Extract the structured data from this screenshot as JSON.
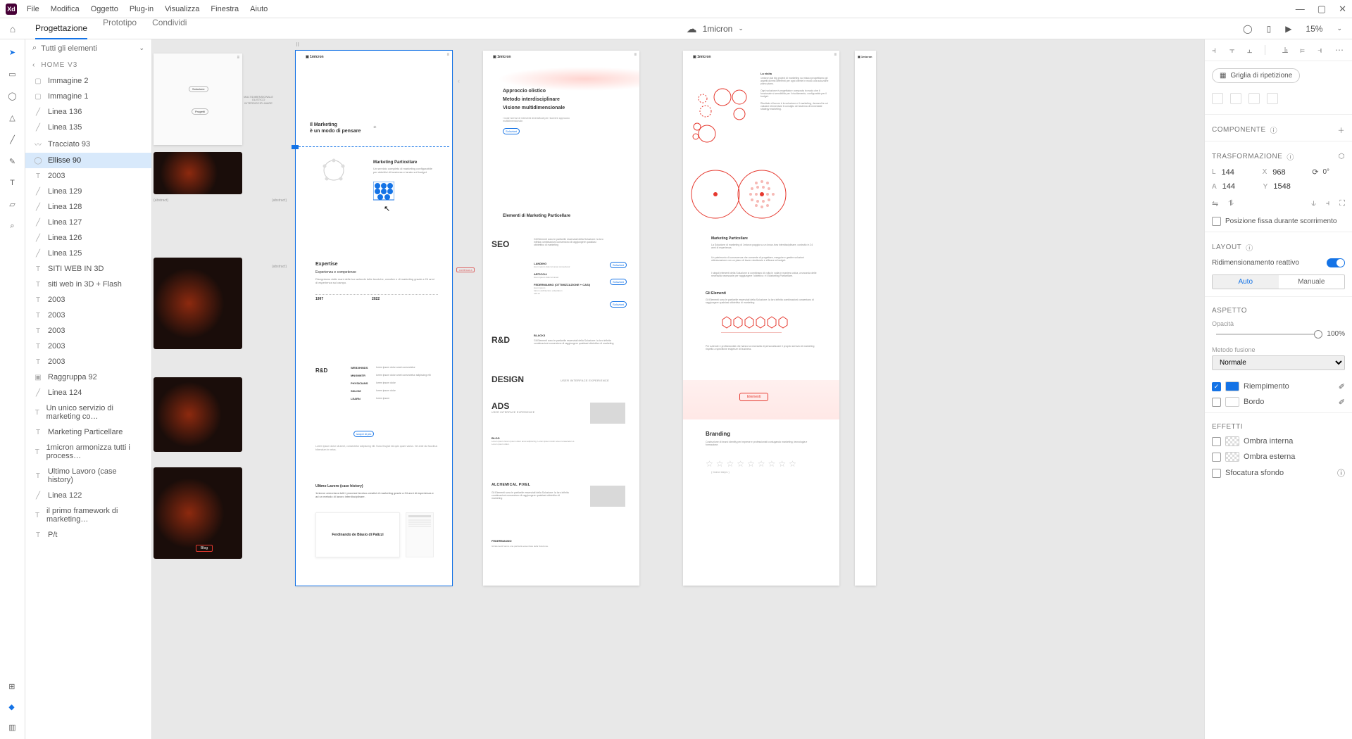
{
  "topbar": {
    "menu": [
      "File",
      "Modifica",
      "Oggetto",
      "Plug-in",
      "Visualizza",
      "Finestra",
      "Aiuto"
    ]
  },
  "secbar": {
    "tabs": [
      "Progettazione",
      "Prototipo",
      "Condividi"
    ],
    "docname": "1micron",
    "zoom": "15%"
  },
  "layers": {
    "filter": "Tutti gli elementi",
    "breadcrumb": "HOME V3",
    "items": [
      {
        "ico": "img",
        "label": "Immagine 2"
      },
      {
        "ico": "img",
        "label": "Immagine 1"
      },
      {
        "ico": "line",
        "label": "Linea 136"
      },
      {
        "ico": "line",
        "label": "Linea 135"
      },
      {
        "ico": "path",
        "label": "Tracciato 93"
      },
      {
        "ico": "ell",
        "label": "Ellisse 90",
        "sel": true
      },
      {
        "ico": "txt",
        "label": "2003"
      },
      {
        "ico": "line",
        "label": "Linea 129"
      },
      {
        "ico": "line",
        "label": "Linea 128"
      },
      {
        "ico": "line",
        "label": "Linea 127"
      },
      {
        "ico": "line",
        "label": "Linea 126"
      },
      {
        "ico": "line",
        "label": "Linea 125"
      },
      {
        "ico": "txt",
        "label": "SITI WEB IN 3D"
      },
      {
        "ico": "txt",
        "label": "siti web in 3D + Flash"
      },
      {
        "ico": "txt",
        "label": "2003"
      },
      {
        "ico": "txt",
        "label": "2003"
      },
      {
        "ico": "txt",
        "label": "2003"
      },
      {
        "ico": "txt",
        "label": "2003"
      },
      {
        "ico": "txt",
        "label": "2003"
      },
      {
        "ico": "grp",
        "label": "Raggruppa 92"
      },
      {
        "ico": "line",
        "label": "Linea 124"
      },
      {
        "ico": "txt",
        "label": "Un unico servizio di marketing co…"
      },
      {
        "ico": "txt",
        "label": "Marketing Particellare"
      },
      {
        "ico": "txt",
        "label": "1micron armonizza tutti i process…"
      },
      {
        "ico": "txt",
        "label": "Ultimo Lavoro (case history)"
      },
      {
        "ico": "line",
        "label": "Linea 122"
      },
      {
        "ico": "txt",
        "label": "il primo framework di marketing…"
      },
      {
        "ico": "txt",
        "label": "P/t"
      }
    ]
  },
  "rpanel": {
    "repeat_grid": "Griglia di ripetizione",
    "component_title": "COMPONENTE",
    "transform_title": "TRASFORMAZIONE",
    "L": "144",
    "X": "968",
    "A": "144",
    "Y": "1548",
    "rot": "0°",
    "fixedpos": "Posizione fissa durante scorrimento",
    "layout_title": "LAYOUT",
    "responsive": "Ridimensionamento reattivo",
    "seg_auto": "Auto",
    "seg_manual": "Manuale",
    "aspect_title": "ASPETTO",
    "opacity_label": "Opacità",
    "opacity_val": "100%",
    "blend_label": "Metodo fusione",
    "blend_value": "Normale",
    "fill_label": "Riempimento",
    "stroke_label": "Bordo",
    "effects_title": "EFFETTI",
    "fx1": "Ombra interna",
    "fx2": "Ombra esterna",
    "fx3": "Sfocatura sfondo"
  },
  "artboards": {
    "ab2": {
      "title1": "Il Marketing",
      "title2": "è un modo di pensare",
      "mp_title": "Marketing Particellare",
      "mp_sub": "Un servizio completo di marketing configurabile per obiettivi di business e tarato sul budget",
      "exp_title": "Expertise",
      "exp_sub": "Esperienza e competenze",
      "exp_body": "Disegniamo dalle mani delle tue aziende tutte tecniche, creative e di marketing grazie a 24 anni di esperienza sul campo.",
      "y1": "1997",
      "y2": "2022",
      "rd_title": "R&D",
      "btn_scopri": "scopri di più",
      "cases_title": "Ultimo Lavoro (case history)",
      "cases_body": "1micron armonizza tutti i processi tecnico-creativi di marketing grazie a 24 anni di esperienza e ad un metodo di lavoro interdisciplinare.",
      "card_name": "Ferdinando de Blasio di Palizzi"
    },
    "ab3": {
      "h1": "Approccio olistico",
      "h2": "Metodo interdisciplinare",
      "h3": "Visione multidimensionale",
      "el_title": "Elementi di Marketing Particellare",
      "seo": "SEO",
      "rd": "R&D",
      "design": "DESIGN",
      "ads": "ADS",
      "ads_sub": "USER INTERFACE EXPERIENCE",
      "black3": "BLACK3",
      "alch": "ALCHEMICAL PIXEL",
      "sol": "Soluzioni"
    },
    "ab4": {
      "brand_title": "Branding",
      "mp_title": "Marketing Particellare",
      "el_title": "Gli Elementi",
      "btn": "Elementi"
    },
    "sidelabel": "continua a"
  }
}
